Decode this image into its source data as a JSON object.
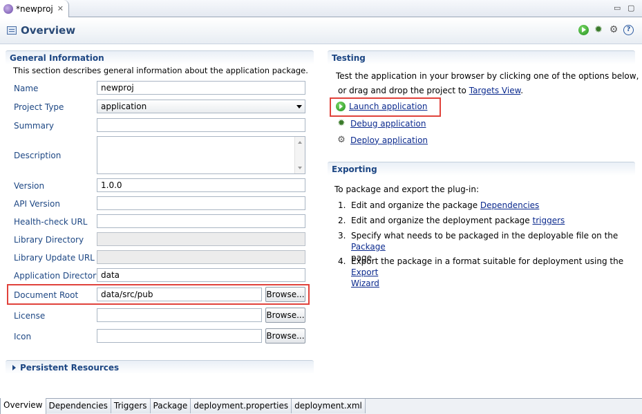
{
  "editor_tab": {
    "title": "*newproj"
  },
  "window_controls": {
    "minimize": "▭",
    "maximize": "▢"
  },
  "header": {
    "title": "Overview"
  },
  "general": {
    "title": "General Information",
    "description": "This section describes general information about the application package.",
    "fields": {
      "name": {
        "label": "Name",
        "value": "newproj"
      },
      "project_type": {
        "label": "Project Type",
        "value": "application"
      },
      "summary": {
        "label": "Summary",
        "value": ""
      },
      "description": {
        "label": "Description",
        "value": ""
      },
      "version": {
        "label": "Version",
        "value": "1.0.0"
      },
      "api_version": {
        "label": "API Version",
        "value": ""
      },
      "health_check": {
        "label": "Health-check URL",
        "value": ""
      },
      "library_dir": {
        "label": "Library Directory",
        "value": ""
      },
      "library_update": {
        "label": "Library Update URL",
        "value": ""
      },
      "app_dir": {
        "label": "Application Directory",
        "value": "data"
      },
      "doc_root": {
        "label": "Document Root",
        "value": "data/src/pub"
      },
      "license": {
        "label": "License",
        "value": ""
      },
      "icon": {
        "label": "Icon",
        "value": ""
      }
    },
    "browse_label": "Browse..."
  },
  "persistent": {
    "title": "Persistent Resources"
  },
  "testing": {
    "title": "Testing",
    "line1": "Test the application in your browser by clicking one of the options below,",
    "line2_prefix": "or drag and drop the project to ",
    "targets_link": "Targets View",
    "line2_suffix": ".",
    "launch": "Launch application",
    "debug": "Debug application",
    "deploy": "Deploy application"
  },
  "exporting": {
    "title": "Exporting",
    "intro": "To package and export the plug-in:",
    "items": [
      {
        "num": "1.",
        "text": "Edit and organize the package ",
        "link": "Dependencies",
        "suffix": ""
      },
      {
        "num": "2.",
        "text": "Edit and organize the deployment package ",
        "link": "triggers",
        "suffix": ""
      },
      {
        "num": "3.",
        "text": "Specify what needs to be packaged in the deployable file on the ",
        "link": "Package",
        "suffix": "page"
      },
      {
        "num": "4.",
        "text": "Export the package in a format suitable for deployment using the ",
        "link": "Export",
        "link2": "Wizard",
        "suffix": ""
      }
    ]
  },
  "bottom_tabs": [
    "Overview",
    "Dependencies",
    "Triggers",
    "Package",
    "deployment.properties",
    "deployment.xml"
  ],
  "colors": {
    "accent_text": "#1c4683",
    "link": "#0b2a8e",
    "highlight": "#e0413a"
  }
}
